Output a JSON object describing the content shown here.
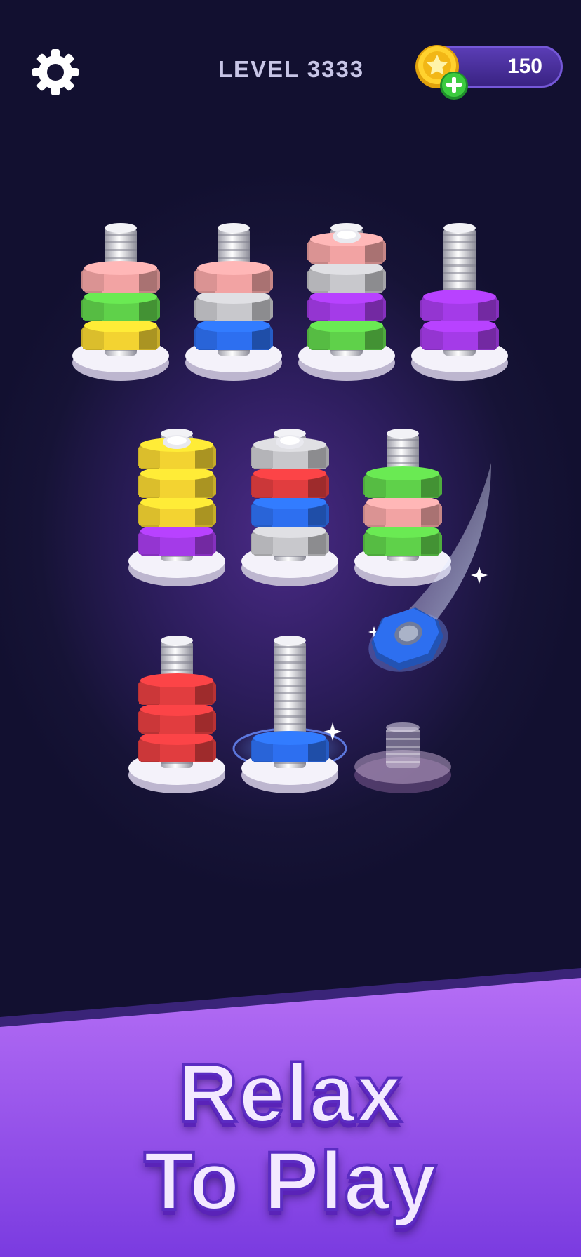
{
  "header": {
    "level_label": "LEVEL",
    "level_number": "3333",
    "coins": "150"
  },
  "icons": {
    "settings": "gear-icon",
    "coin": "star-coin-icon",
    "add_coins": "plus-icon"
  },
  "colors": {
    "pink": "#f2a3a3",
    "green": "#5fd14a",
    "yellow": "#f3d331",
    "silver": "#c8c8cc",
    "blue": "#2d6ff0",
    "purple": "#a43be8",
    "red": "#e13d3f"
  },
  "board": {
    "bolts": [
      {
        "nuts": [
          "yellow",
          "green",
          "pink"
        ],
        "capped": false
      },
      {
        "nuts": [
          "blue",
          "silver",
          "pink"
        ],
        "capped": false
      },
      {
        "nuts": [
          "green",
          "purple",
          "silver",
          "pink"
        ],
        "capped": true
      },
      {
        "nuts": [
          "purple",
          "purple"
        ],
        "capped": false
      },
      {
        "nuts": [
          "purple",
          "yellow",
          "yellow",
          "yellow"
        ],
        "capped": true
      },
      {
        "nuts": [
          "silver",
          "blue",
          "red",
          "silver"
        ],
        "capped": true
      },
      {
        "nuts": [
          "green",
          "pink",
          "green"
        ],
        "capped": false
      },
      {
        "nuts": [
          "red",
          "red",
          "red"
        ],
        "capped": false
      },
      {
        "nuts": [
          "blue"
        ],
        "capped": false,
        "glow": true
      },
      {
        "nuts": [],
        "capped": false,
        "ghost": true
      }
    ],
    "flying_nut": "blue"
  },
  "banner": {
    "line1": "Relax",
    "line2": "To Play"
  }
}
